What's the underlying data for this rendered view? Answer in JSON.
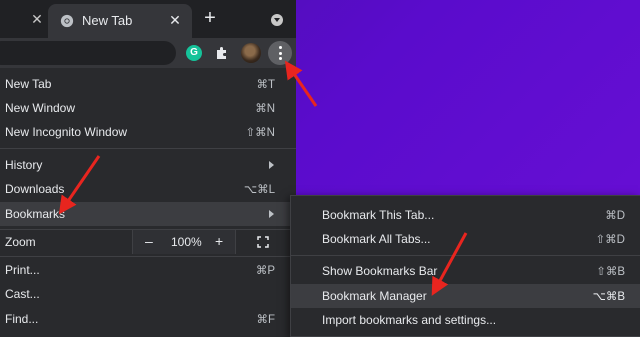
{
  "tabs": {
    "active_title": "New Tab"
  },
  "extensions": {
    "grammarly_letter": "G"
  },
  "menu": {
    "items": [
      {
        "label": "New Tab",
        "shortcut": "⌘T"
      },
      {
        "label": "New Window",
        "shortcut": "⌘N"
      },
      {
        "label": "New Incognito Window",
        "shortcut": "⇧⌘N"
      },
      {
        "label": "History",
        "shortcut": ""
      },
      {
        "label": "Downloads",
        "shortcut": "⌥⌘L"
      },
      {
        "label": "Bookmarks",
        "shortcut": ""
      },
      {
        "label": "Zoom",
        "shortcut": ""
      },
      {
        "label": "Print...",
        "shortcut": "⌘P"
      },
      {
        "label": "Cast...",
        "shortcut": ""
      },
      {
        "label": "Find...",
        "shortcut": "⌘F"
      }
    ],
    "zoom": {
      "minus": "–",
      "value": "100%",
      "plus": "+"
    }
  },
  "bookmarks_submenu": {
    "items": [
      {
        "label": "Bookmark This Tab...",
        "shortcut": "⌘D"
      },
      {
        "label": "Bookmark All Tabs...",
        "shortcut": "⇧⌘D"
      },
      {
        "label": "Show Bookmarks Bar",
        "shortcut": "⇧⌘B"
      },
      {
        "label": "Bookmark Manager",
        "shortcut": "⌥⌘B"
      },
      {
        "label": "Import bookmarks and settings...",
        "shortcut": ""
      }
    ]
  },
  "colors": {
    "background_purple": "#5a0ccc",
    "menu_bg": "#292a2d",
    "highlight": "#3c3d41",
    "annotation_red": "#e8251f"
  }
}
